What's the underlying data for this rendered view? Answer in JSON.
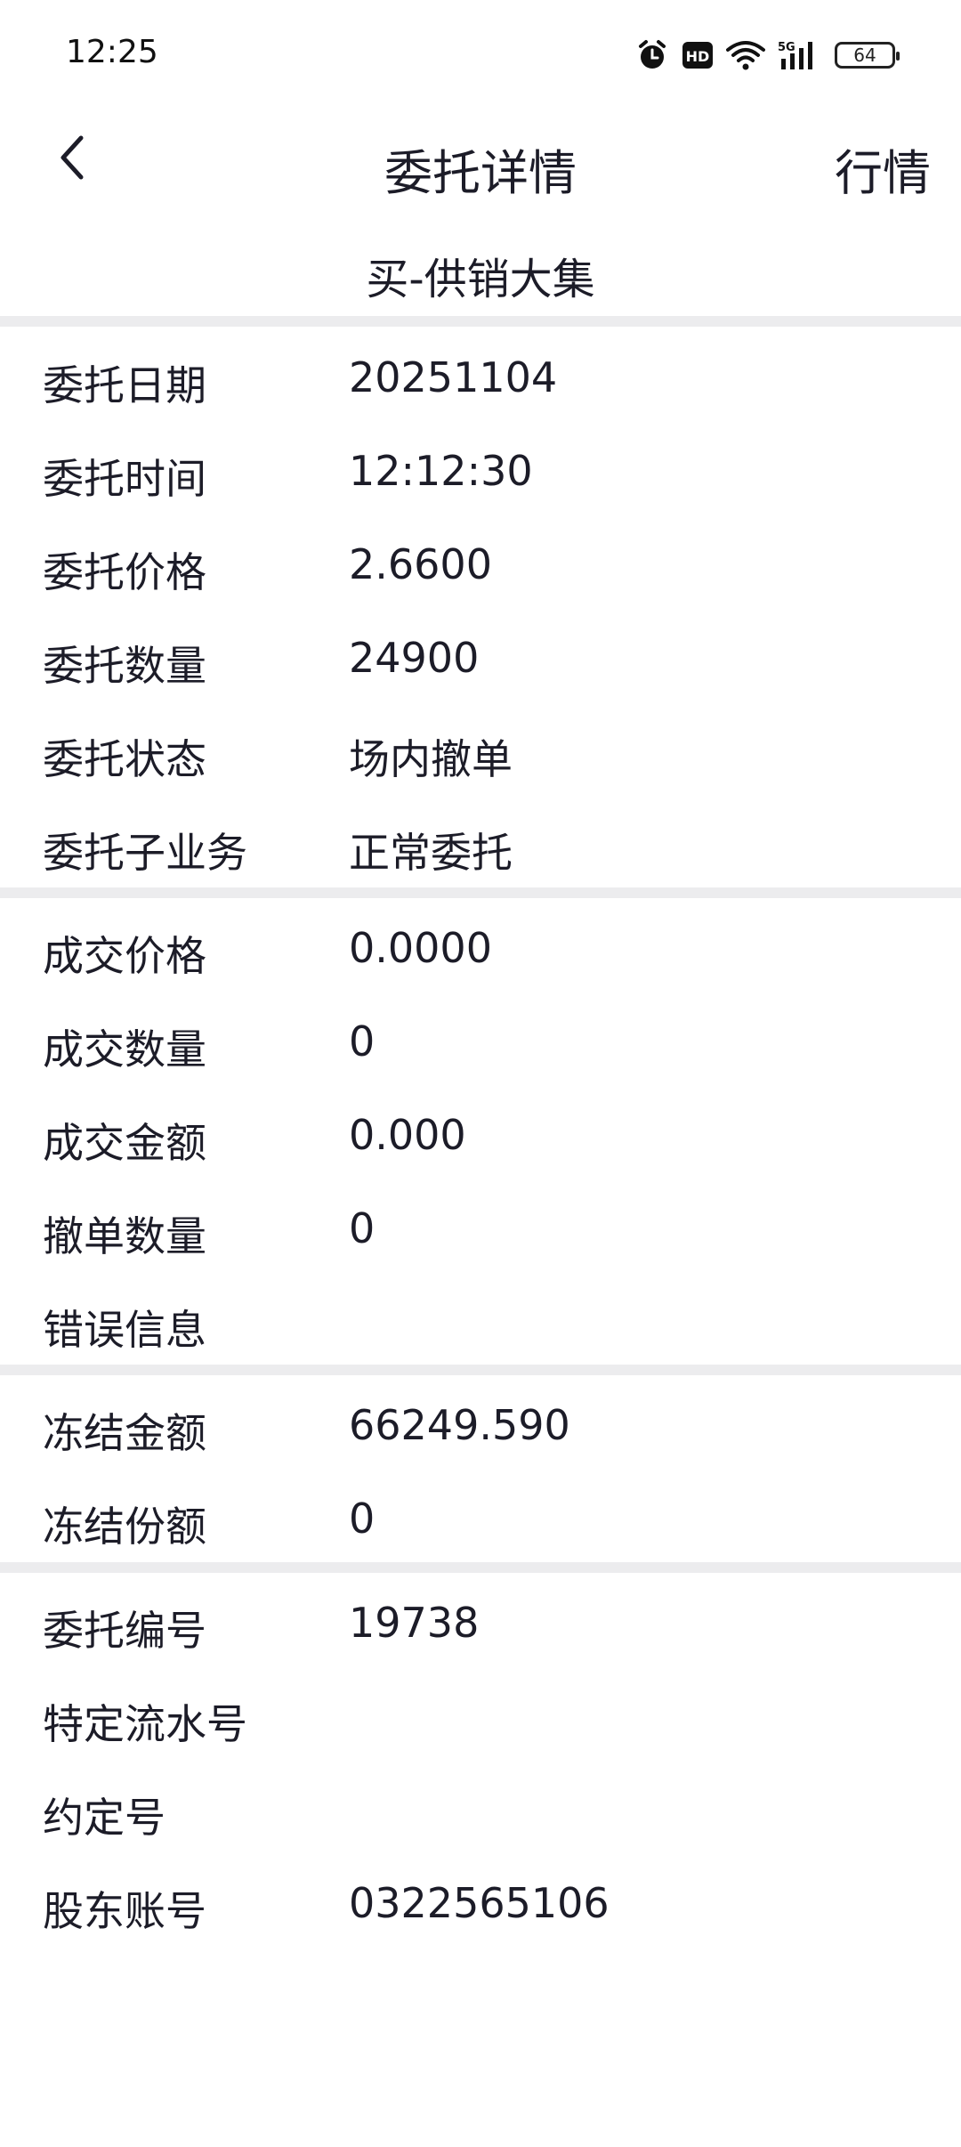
{
  "status_bar": {
    "time": "12:25",
    "battery": "64",
    "icons": [
      "alarm-icon",
      "hd-icon",
      "wifi-icon",
      "signal-5g-icon",
      "battery-icon"
    ]
  },
  "header": {
    "title": "委托详情",
    "right_action": "行情",
    "back_icon": "chevron-left-icon"
  },
  "subtitle": "买-供销大集",
  "sections": [
    [
      {
        "label": "委托日期",
        "value": "20251104"
      },
      {
        "label": "委托时间",
        "value": "12:12:30"
      },
      {
        "label": "委托价格",
        "value": "2.6600"
      },
      {
        "label": "委托数量",
        "value": "24900"
      },
      {
        "label": "委托状态",
        "value": "场内撤单"
      },
      {
        "label": "委托子业务",
        "value": "正常委托"
      }
    ],
    [
      {
        "label": "成交价格",
        "value": "0.0000"
      },
      {
        "label": "成交数量",
        "value": "0"
      },
      {
        "label": "成交金额",
        "value": "0.000"
      },
      {
        "label": "撤单数量",
        "value": "0"
      },
      {
        "label": "错误信息",
        "value": ""
      }
    ],
    [
      {
        "label": "冻结金额",
        "value": "66249.590"
      },
      {
        "label": "冻结份额",
        "value": "0"
      }
    ],
    [
      {
        "label": "委托编号",
        "value": "19738"
      },
      {
        "label": "特定流水号",
        "value": ""
      },
      {
        "label": "约定号",
        "value": ""
      },
      {
        "label": "股东账号",
        "value": "0322565106"
      }
    ]
  ]
}
